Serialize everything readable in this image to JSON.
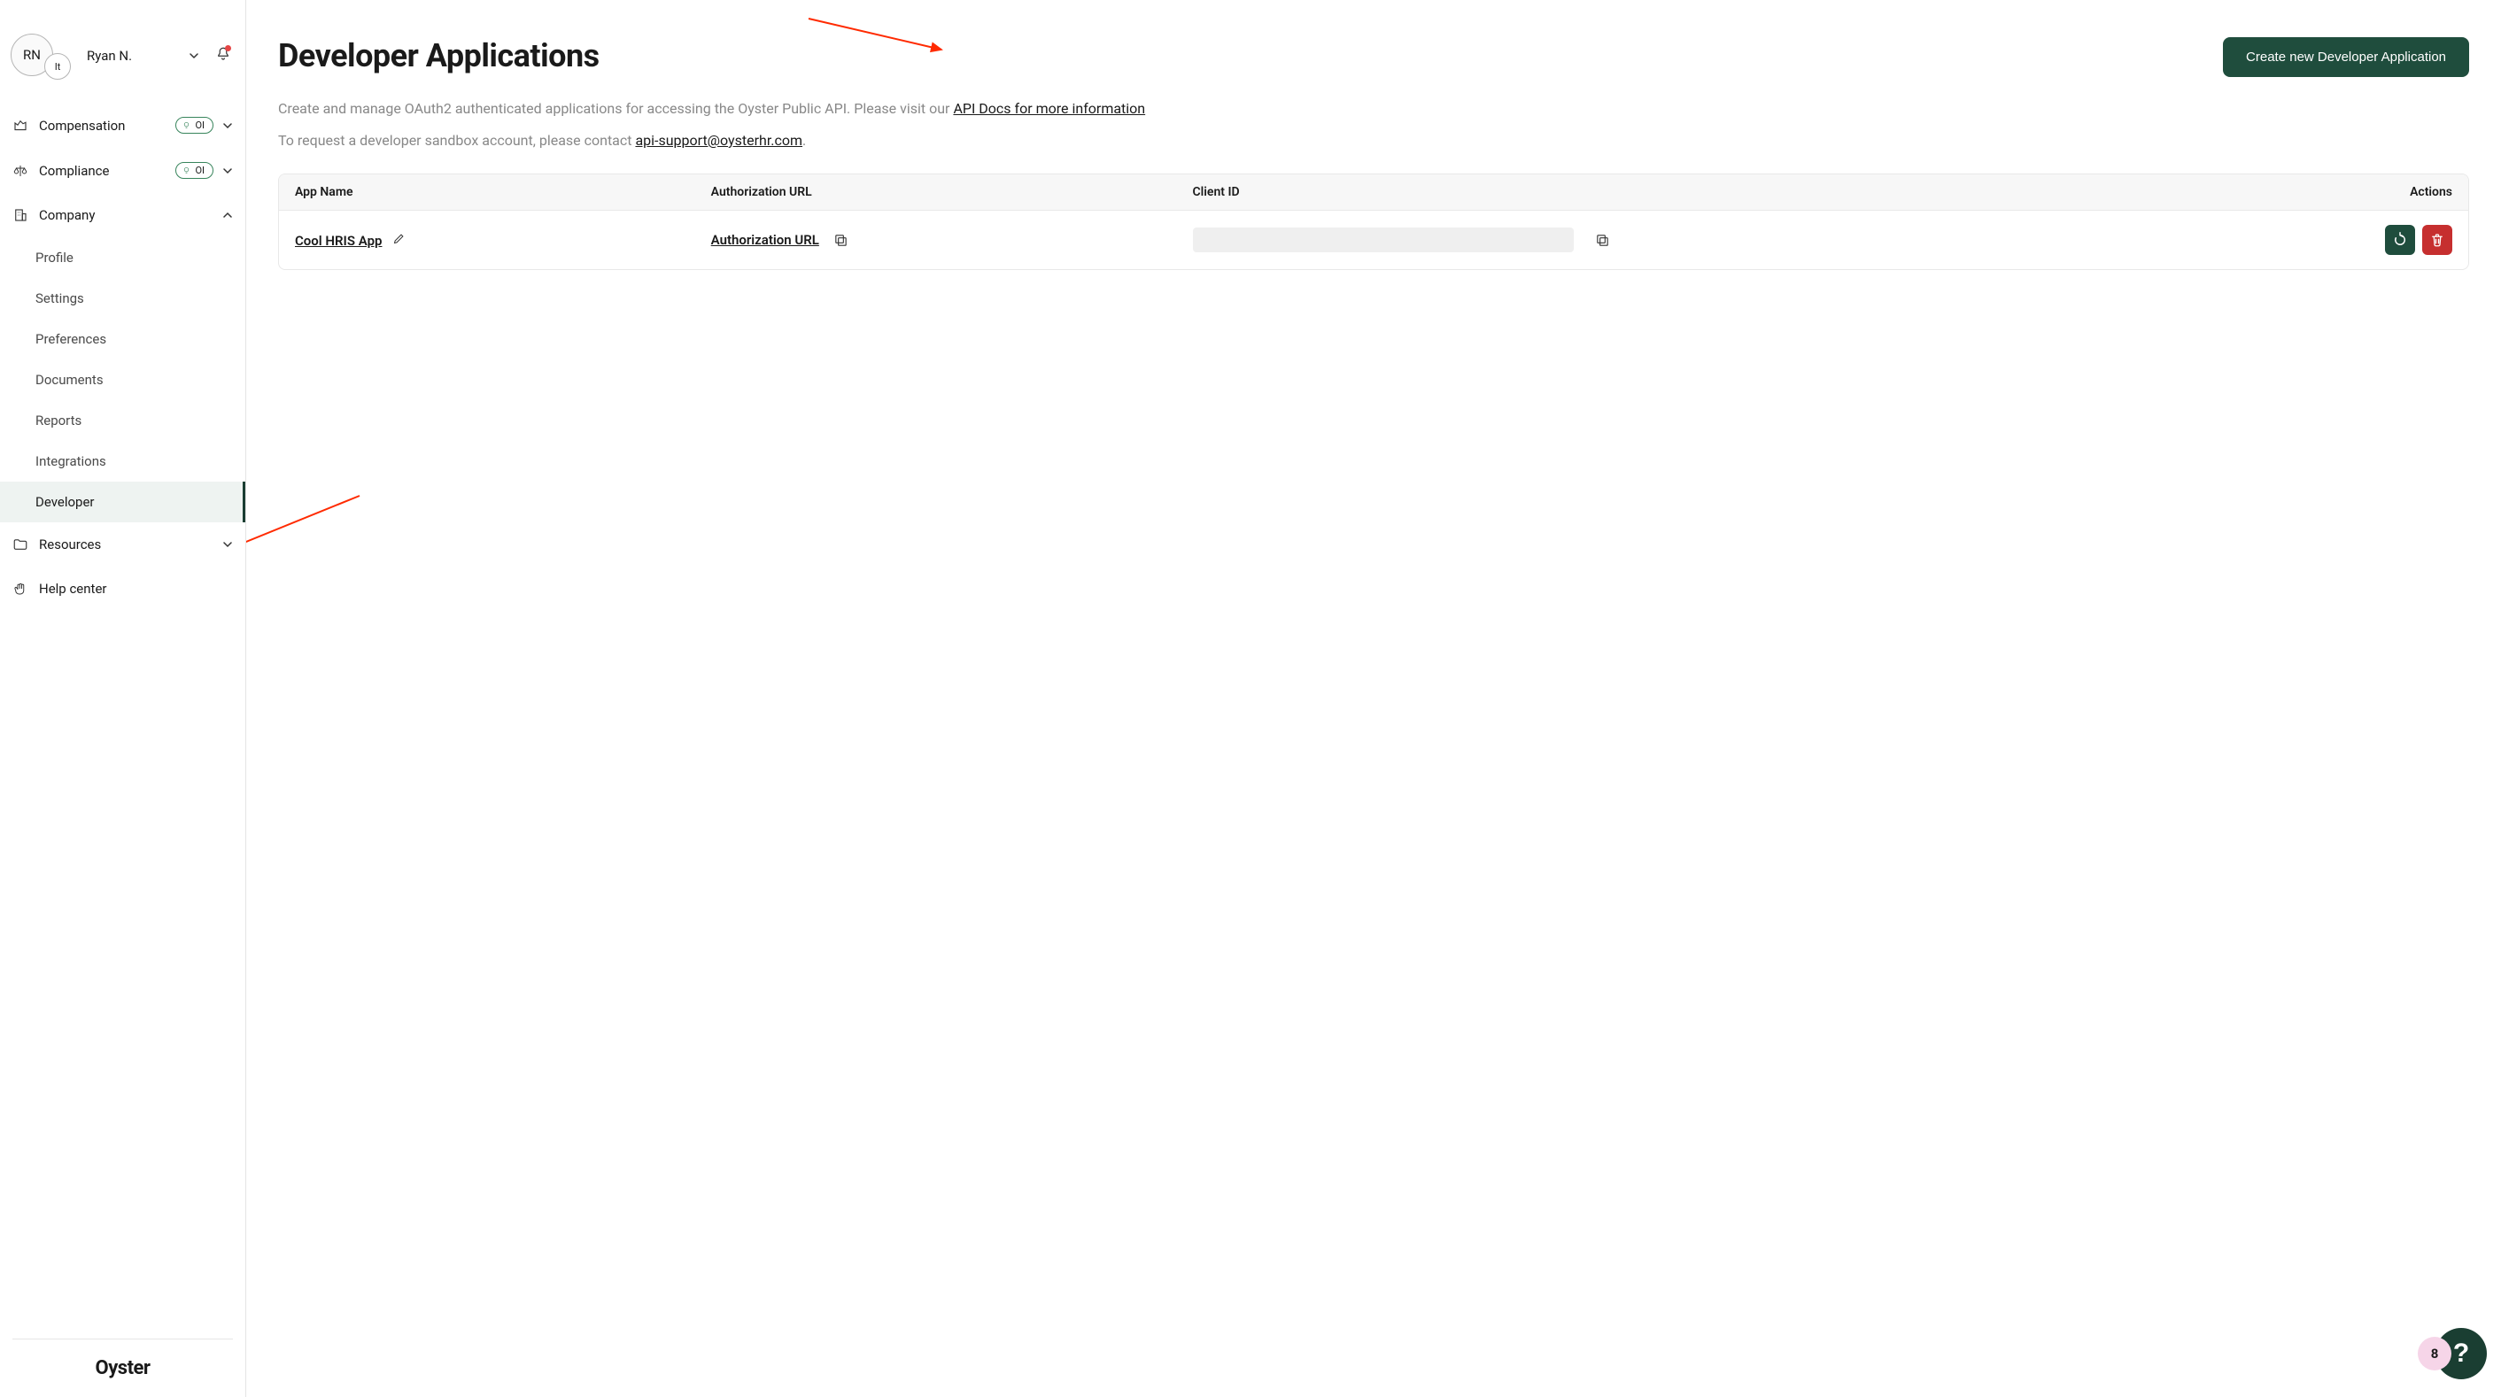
{
  "user": {
    "initials": "RN",
    "sub_initials": "It",
    "name": "Ryan N."
  },
  "sidebar": {
    "items": [
      {
        "label": "Compensation",
        "badge": "OI",
        "expandable": true
      },
      {
        "label": "Compliance",
        "badge": "OI",
        "expandable": true
      },
      {
        "label": "Company",
        "expandable": true,
        "expanded": true
      },
      {
        "label": "Resources",
        "expandable": true
      },
      {
        "label": "Help center"
      }
    ],
    "company_sub": [
      {
        "label": "Profile"
      },
      {
        "label": "Settings"
      },
      {
        "label": "Preferences"
      },
      {
        "label": "Documents"
      },
      {
        "label": "Reports"
      },
      {
        "label": "Integrations"
      },
      {
        "label": "Developer",
        "active": true
      }
    ],
    "brand": "Oyster"
  },
  "page": {
    "title": "Developer Applications",
    "create_btn": "Create new Developer Application",
    "intro_pre": "Create and manage OAuth2 authenticated applications for accessing the Oyster Public API. Please visit our ",
    "intro_link": "API Docs for more information",
    "sandbox_pre": "To request a developer sandbox account, please contact ",
    "sandbox_email": "api-support@oysterhr.com",
    "sandbox_post": "."
  },
  "table": {
    "headers": {
      "app_name": "App Name",
      "auth_url": "Authorization URL",
      "client_id": "Client ID",
      "actions": "Actions"
    },
    "rows": [
      {
        "app_name": "Cool HRIS App",
        "auth_label": "Authorization URL",
        "client_id": ""
      }
    ]
  },
  "help": {
    "badge": "8",
    "label": "?"
  }
}
